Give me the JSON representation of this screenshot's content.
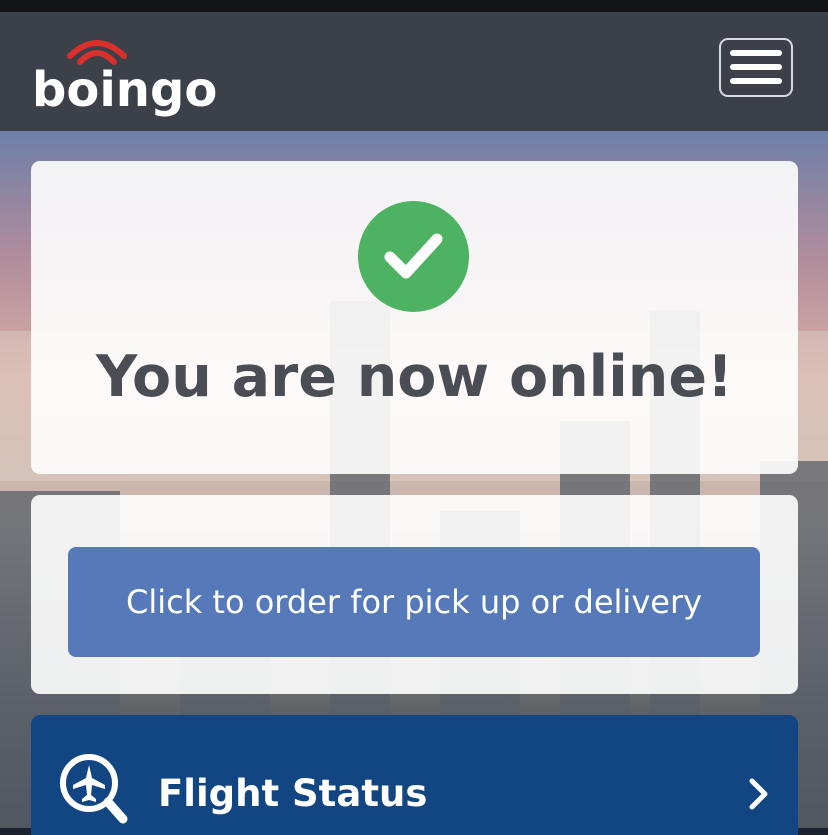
{
  "header": {
    "logo_text": "boingo",
    "menu_icon": "hamburger-menu-icon",
    "brand_wave_color": "#d9302b"
  },
  "online_card": {
    "icon": "check-circle-icon",
    "message": "You are now online!",
    "accent_color": "#4db363"
  },
  "order": {
    "button_label": "Click to order for pick up or delivery",
    "button_color": "#5579b9"
  },
  "flight_status": {
    "icon": "plane-search-icon",
    "label": "Flight Status",
    "chevron": "chevron-right-icon",
    "color": "#124682"
  }
}
